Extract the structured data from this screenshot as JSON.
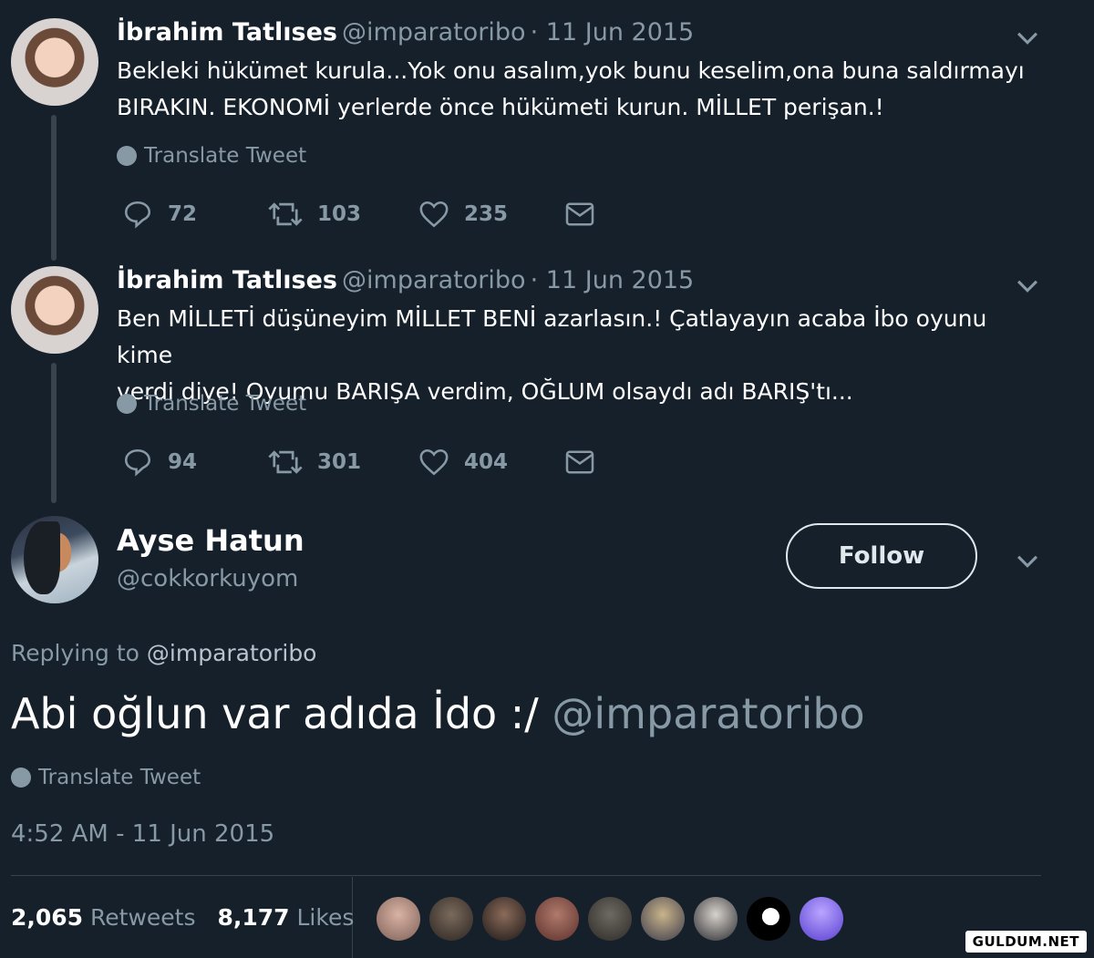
{
  "tweets": [
    {
      "name": "İbrahim Tatlıses",
      "handle": "@imparatoribo",
      "date": "· 11 Jun 2015",
      "text_line1": "Bekleki hükümet kurula...Yok onu asalım,yok bunu keselim,ona buna saldırmayı",
      "text_line2": "BIRAKIN. EKONOMİ yerlerde önce hükümeti kurun. MİLLET perişan.!",
      "translate": "Translate Tweet",
      "replies": "72",
      "retweets": "103",
      "likes": "235"
    },
    {
      "name": "İbrahim Tatlıses",
      "handle": "@imparatoribo",
      "date": "· 11 Jun 2015",
      "text_line1": "Ben MİLLETİ düşüneyim MİLLET BENİ azarlasın.! Çatlayayın acaba İbo oyunu kime",
      "text_line2": "verdi diye! Oyumu BARIŞA verdim, OĞLUM olsaydı adı BARIŞ'tı...",
      "translate": "Translate Tweet",
      "replies": "94",
      "retweets": "301",
      "likes": "404"
    }
  ],
  "main": {
    "name": "Ayse Hatun",
    "handle": "@cokkorkuyom",
    "follow_label": "Follow",
    "replying_prefix": "Replying to",
    "replying_handle": "@imparatoribo",
    "text": "Abi oğlun var adıda İdo :/ ",
    "text_mention": "@imparatoribo",
    "translate": "Translate Tweet",
    "timestamp": "4:52 AM - 11 Jun 2015",
    "retweet_count": "2,065",
    "retweet_label": "Retweets",
    "like_count": "8,177",
    "like_label": "Likes"
  },
  "watermark": "GULDUM.NET",
  "colors": {
    "background": "#15202b",
    "secondary_text": "#8899a6",
    "divider": "#38444d"
  }
}
